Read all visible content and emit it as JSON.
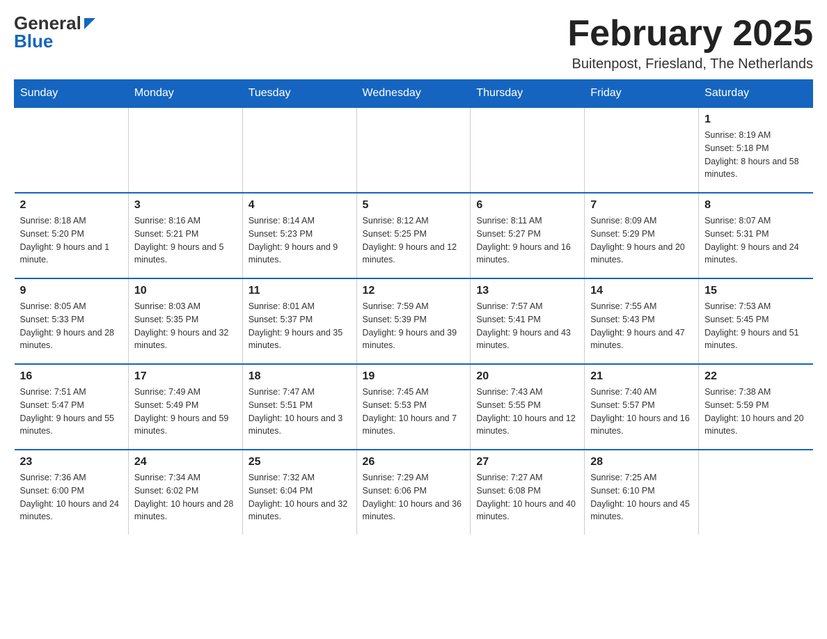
{
  "header": {
    "logo_general": "General",
    "logo_blue": "Blue",
    "month_title": "February 2025",
    "location": "Buitenpost, Friesland, The Netherlands"
  },
  "weekdays": [
    "Sunday",
    "Monday",
    "Tuesday",
    "Wednesday",
    "Thursday",
    "Friday",
    "Saturday"
  ],
  "weeks": [
    [
      {
        "day": "",
        "info": ""
      },
      {
        "day": "",
        "info": ""
      },
      {
        "day": "",
        "info": ""
      },
      {
        "day": "",
        "info": ""
      },
      {
        "day": "",
        "info": ""
      },
      {
        "day": "",
        "info": ""
      },
      {
        "day": "1",
        "info": "Sunrise: 8:19 AM\nSunset: 5:18 PM\nDaylight: 8 hours and 58 minutes."
      }
    ],
    [
      {
        "day": "2",
        "info": "Sunrise: 8:18 AM\nSunset: 5:20 PM\nDaylight: 9 hours and 1 minute."
      },
      {
        "day": "3",
        "info": "Sunrise: 8:16 AM\nSunset: 5:21 PM\nDaylight: 9 hours and 5 minutes."
      },
      {
        "day": "4",
        "info": "Sunrise: 8:14 AM\nSunset: 5:23 PM\nDaylight: 9 hours and 9 minutes."
      },
      {
        "day": "5",
        "info": "Sunrise: 8:12 AM\nSunset: 5:25 PM\nDaylight: 9 hours and 12 minutes."
      },
      {
        "day": "6",
        "info": "Sunrise: 8:11 AM\nSunset: 5:27 PM\nDaylight: 9 hours and 16 minutes."
      },
      {
        "day": "7",
        "info": "Sunrise: 8:09 AM\nSunset: 5:29 PM\nDaylight: 9 hours and 20 minutes."
      },
      {
        "day": "8",
        "info": "Sunrise: 8:07 AM\nSunset: 5:31 PM\nDaylight: 9 hours and 24 minutes."
      }
    ],
    [
      {
        "day": "9",
        "info": "Sunrise: 8:05 AM\nSunset: 5:33 PM\nDaylight: 9 hours and 28 minutes."
      },
      {
        "day": "10",
        "info": "Sunrise: 8:03 AM\nSunset: 5:35 PM\nDaylight: 9 hours and 32 minutes."
      },
      {
        "day": "11",
        "info": "Sunrise: 8:01 AM\nSunset: 5:37 PM\nDaylight: 9 hours and 35 minutes."
      },
      {
        "day": "12",
        "info": "Sunrise: 7:59 AM\nSunset: 5:39 PM\nDaylight: 9 hours and 39 minutes."
      },
      {
        "day": "13",
        "info": "Sunrise: 7:57 AM\nSunset: 5:41 PM\nDaylight: 9 hours and 43 minutes."
      },
      {
        "day": "14",
        "info": "Sunrise: 7:55 AM\nSunset: 5:43 PM\nDaylight: 9 hours and 47 minutes."
      },
      {
        "day": "15",
        "info": "Sunrise: 7:53 AM\nSunset: 5:45 PM\nDaylight: 9 hours and 51 minutes."
      }
    ],
    [
      {
        "day": "16",
        "info": "Sunrise: 7:51 AM\nSunset: 5:47 PM\nDaylight: 9 hours and 55 minutes."
      },
      {
        "day": "17",
        "info": "Sunrise: 7:49 AM\nSunset: 5:49 PM\nDaylight: 9 hours and 59 minutes."
      },
      {
        "day": "18",
        "info": "Sunrise: 7:47 AM\nSunset: 5:51 PM\nDaylight: 10 hours and 3 minutes."
      },
      {
        "day": "19",
        "info": "Sunrise: 7:45 AM\nSunset: 5:53 PM\nDaylight: 10 hours and 7 minutes."
      },
      {
        "day": "20",
        "info": "Sunrise: 7:43 AM\nSunset: 5:55 PM\nDaylight: 10 hours and 12 minutes."
      },
      {
        "day": "21",
        "info": "Sunrise: 7:40 AM\nSunset: 5:57 PM\nDaylight: 10 hours and 16 minutes."
      },
      {
        "day": "22",
        "info": "Sunrise: 7:38 AM\nSunset: 5:59 PM\nDaylight: 10 hours and 20 minutes."
      }
    ],
    [
      {
        "day": "23",
        "info": "Sunrise: 7:36 AM\nSunset: 6:00 PM\nDaylight: 10 hours and 24 minutes."
      },
      {
        "day": "24",
        "info": "Sunrise: 7:34 AM\nSunset: 6:02 PM\nDaylight: 10 hours and 28 minutes."
      },
      {
        "day": "25",
        "info": "Sunrise: 7:32 AM\nSunset: 6:04 PM\nDaylight: 10 hours and 32 minutes."
      },
      {
        "day": "26",
        "info": "Sunrise: 7:29 AM\nSunset: 6:06 PM\nDaylight: 10 hours and 36 minutes."
      },
      {
        "day": "27",
        "info": "Sunrise: 7:27 AM\nSunset: 6:08 PM\nDaylight: 10 hours and 40 minutes."
      },
      {
        "day": "28",
        "info": "Sunrise: 7:25 AM\nSunset: 6:10 PM\nDaylight: 10 hours and 45 minutes."
      },
      {
        "day": "",
        "info": ""
      }
    ]
  ]
}
